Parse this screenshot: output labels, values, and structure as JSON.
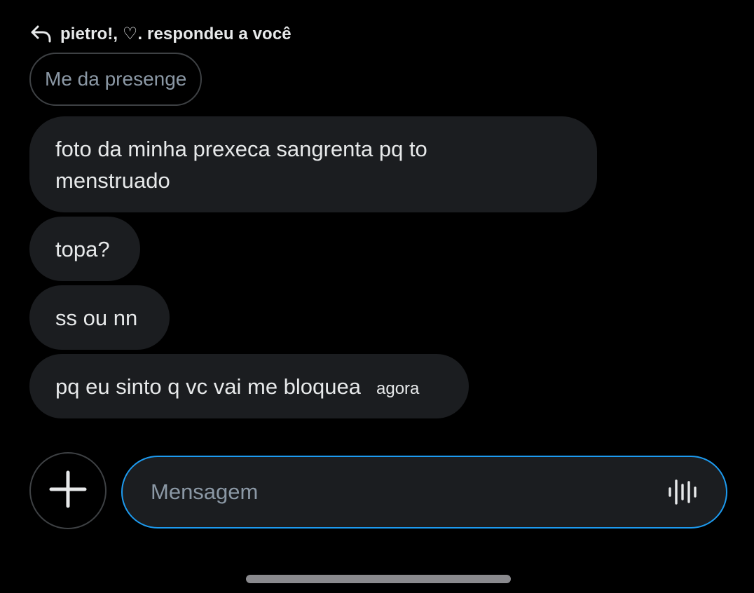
{
  "reply_header": {
    "text": "pietro!, ♡. respondeu a você",
    "icon": "reply-arrow-icon"
  },
  "quoted_message": "Me da presenge",
  "messages": [
    {
      "text": "foto da minha prexeca sangrenta pq to menstruado"
    },
    {
      "text": "topa?"
    },
    {
      "text": "ss ou nn"
    },
    {
      "text": "pq eu sinto q vc vai me bloquea",
      "time": "agora"
    }
  ],
  "composer": {
    "add_icon": "plus-icon",
    "placeholder": "Mensagem",
    "value": "",
    "voice_icon": "voice-waveform-icon"
  },
  "colors": {
    "background": "#000000",
    "bubble": "#1b1d20",
    "text": "#e7e9ea",
    "muted": "#8b98a5",
    "accent": "#1d9bf0",
    "border": "#3e4144"
  }
}
